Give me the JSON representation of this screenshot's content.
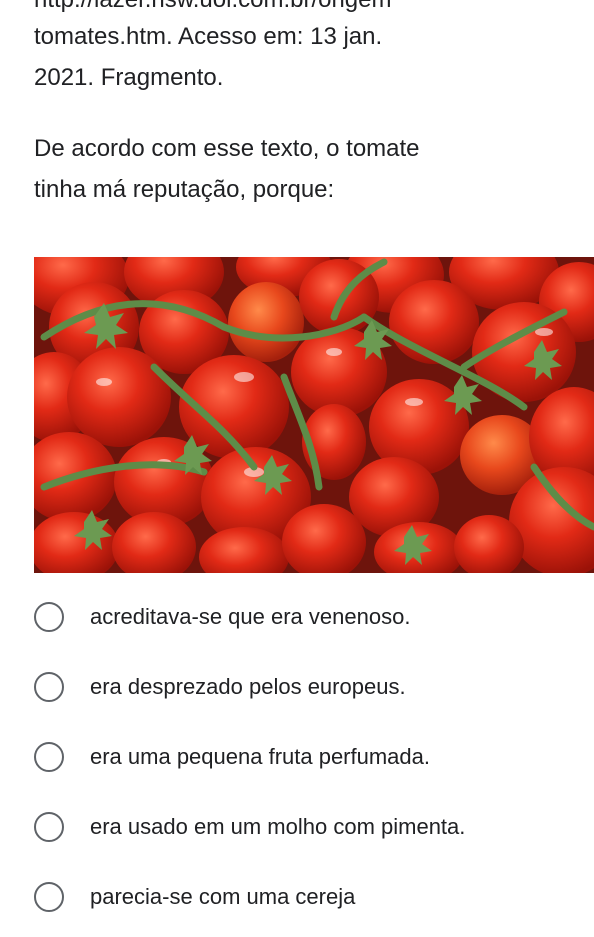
{
  "source": {
    "cut_line": "http://lazer.hsw.uol.com.br/origem",
    "line1": "tomates.htm. Acesso em: 13 jan.",
    "line2": "2021. Fragmento."
  },
  "question": {
    "line1": "De acordo com esse texto, o tomate",
    "line2": "tinha má reputação, porque:"
  },
  "image": {
    "subject": "tomatoes-on-vine"
  },
  "options": [
    {
      "label": "acreditava-se que era venenoso.",
      "selected": false
    },
    {
      "label": "era desprezado pelos europeus.",
      "selected": false
    },
    {
      "label": "era uma pequena fruta perfumada.",
      "selected": false
    },
    {
      "label": "era usado em um molho com pimenta.",
      "selected": false
    },
    {
      "label": "parecia-se com uma cereja",
      "selected": false
    }
  ],
  "colors": {
    "radio_border": "#5f6368",
    "text": "#202124"
  }
}
